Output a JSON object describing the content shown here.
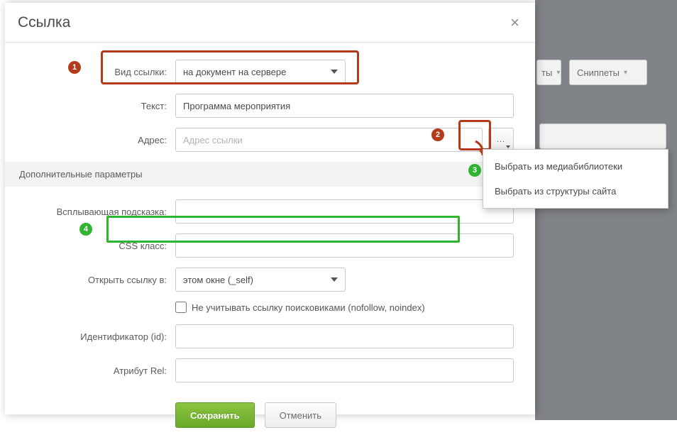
{
  "dialog": {
    "title": "Ссылка",
    "fields": {
      "link_type_label": "Вид ссылки:",
      "link_type_value": "на документ на сервере",
      "text_label": "Текст:",
      "text_value": "Программа мероприятия",
      "address_label": "Адрес:",
      "address_placeholder": "Адрес ссылки",
      "section_title": "Дополнительные параметры",
      "tooltip_label": "Всплывающая подсказка:",
      "css_label": "CSS класс:",
      "target_label": "Открыть ссылку в:",
      "target_value": "этом окне (_self)",
      "nofollow_label": "Не учитывать ссылку поисковиками (nofollow, noindex)",
      "id_label": "Идентификатор (id):",
      "rel_label": "Атрибут Rel:"
    },
    "buttons": {
      "save": "Сохранить",
      "cancel": "Отменить"
    }
  },
  "dropdown": {
    "opt1": "Выбрать из медиабиблиотеки",
    "opt2": "Выбрать из структуры сайта"
  },
  "markers": {
    "m1": "1",
    "m2": "2",
    "m3": "3",
    "m4": "4"
  },
  "background": {
    "btn1_suffix": "ты",
    "btn2": "Сниппеты"
  }
}
